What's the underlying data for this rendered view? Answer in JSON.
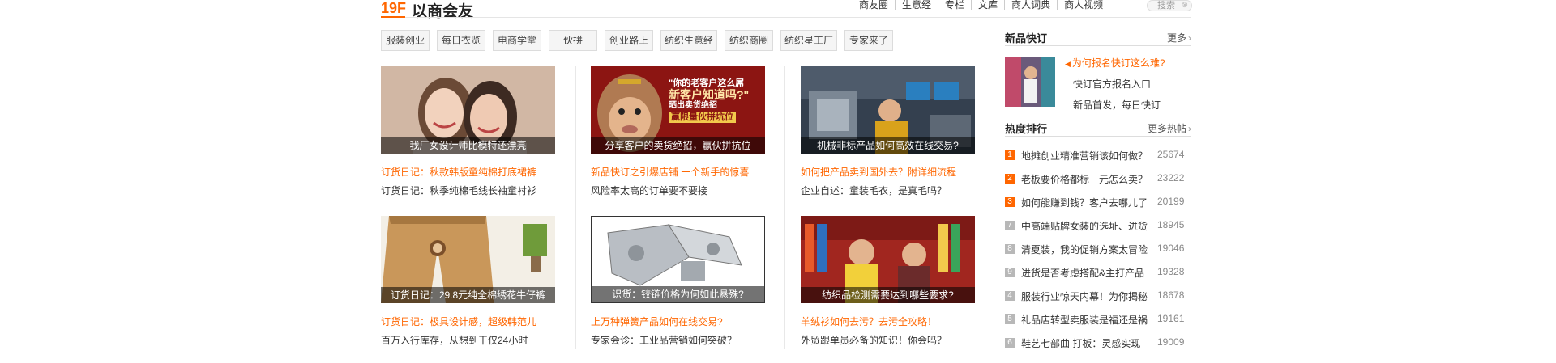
{
  "header": {
    "floor_number": "19F",
    "floor_title": "以商会友",
    "links": [
      "商友圈",
      "生意经",
      "专栏",
      "文库",
      "商人词典",
      "商人视频"
    ],
    "search_placeholder": "搜索"
  },
  "tags": [
    "服装创业",
    "每日衣览",
    "电商学堂",
    "伙拼",
    "创业路上",
    "纺织生意经",
    "纺织商圈",
    "纺织星工厂",
    "专家来了"
  ],
  "cards": [
    {
      "caption": "我厂女设计师比模特还漂亮",
      "link1": "订货日记：秋款韩版童纯棉打底裙裤",
      "link2": "订货日记：秋季纯棉毛线长袖童衬衫"
    },
    {
      "caption": "分享客户的卖货绝招，赢伙拼抗位",
      "link1": "新品快订之引爆店铺 一个新手的惊喜",
      "link2": "风险率太高的订单要不要接",
      "banner_line1": "\"你的老客户这么屌",
      "banner_line2": "新客户知道吗?\"",
      "banner_line3": "晒出卖货绝招",
      "banner_line4": "赢限量伙拼坑位"
    },
    {
      "caption": "机械非标产品如何高效在线交易?",
      "link1": "如何把产品卖到国外去？附详细流程",
      "link2": "企业自述：童装毛衣，是真毛吗？"
    },
    {
      "caption": "订货日记：29.8元纯全棉绣花牛仔裤",
      "link1": "订货日记：极具设计感，超级韩范儿",
      "link2": "百万入行库存，从想到干仅24小时"
    },
    {
      "caption": "识货：铰链价格为何如此悬殊?",
      "link1": "上万种弹簧产品如何在线交易?",
      "link2": "专家会诊：工业品营销如何突破？"
    },
    {
      "caption": "纺织品检测需要达到哪些要求?",
      "link1": "羊绒衫如何去污？去污全攻略！",
      "link2": "外贸跟单员必备的知识！你会吗？"
    }
  ],
  "sidebar": {
    "kuaiding": {
      "title": "新品快订",
      "more": "更多",
      "links": [
        "为何报名快订这么难?",
        "快订官方报名入口",
        "新品首发，每日快订"
      ]
    },
    "ranking": {
      "title": "热度排行",
      "more": "更多热帖",
      "items": [
        {
          "rank": "1",
          "text": "地摊创业精准营销该如何做？",
          "views": "25674"
        },
        {
          "rank": "2",
          "text": "老板要价格都标一元怎么卖？",
          "views": "23222"
        },
        {
          "rank": "3",
          "text": "如何能赚到钱？客户去哪儿了",
          "views": "20199"
        },
        {
          "rank": "7",
          "text": "中高端贴牌女装的选址、进货",
          "views": "18945"
        },
        {
          "rank": "8",
          "text": "清夏装，我的促销方案太冒险",
          "views": "19046"
        },
        {
          "rank": "9",
          "text": "进货是否考虑搭配&主打产品",
          "views": "19328"
        },
        {
          "rank": "4",
          "text": "服装行业惊天内幕！为你揭秘",
          "views": "18678"
        },
        {
          "rank": "5",
          "text": "礼品店转型卖服装是福还是祸",
          "views": "19161"
        },
        {
          "rank": "6",
          "text": "鞋艺七部曲 打板：灵感实现",
          "views": "19009"
        }
      ]
    }
  },
  "colors": {
    "accent": "#ff6600",
    "text": "#333333",
    "border": "#dcdcdc"
  }
}
